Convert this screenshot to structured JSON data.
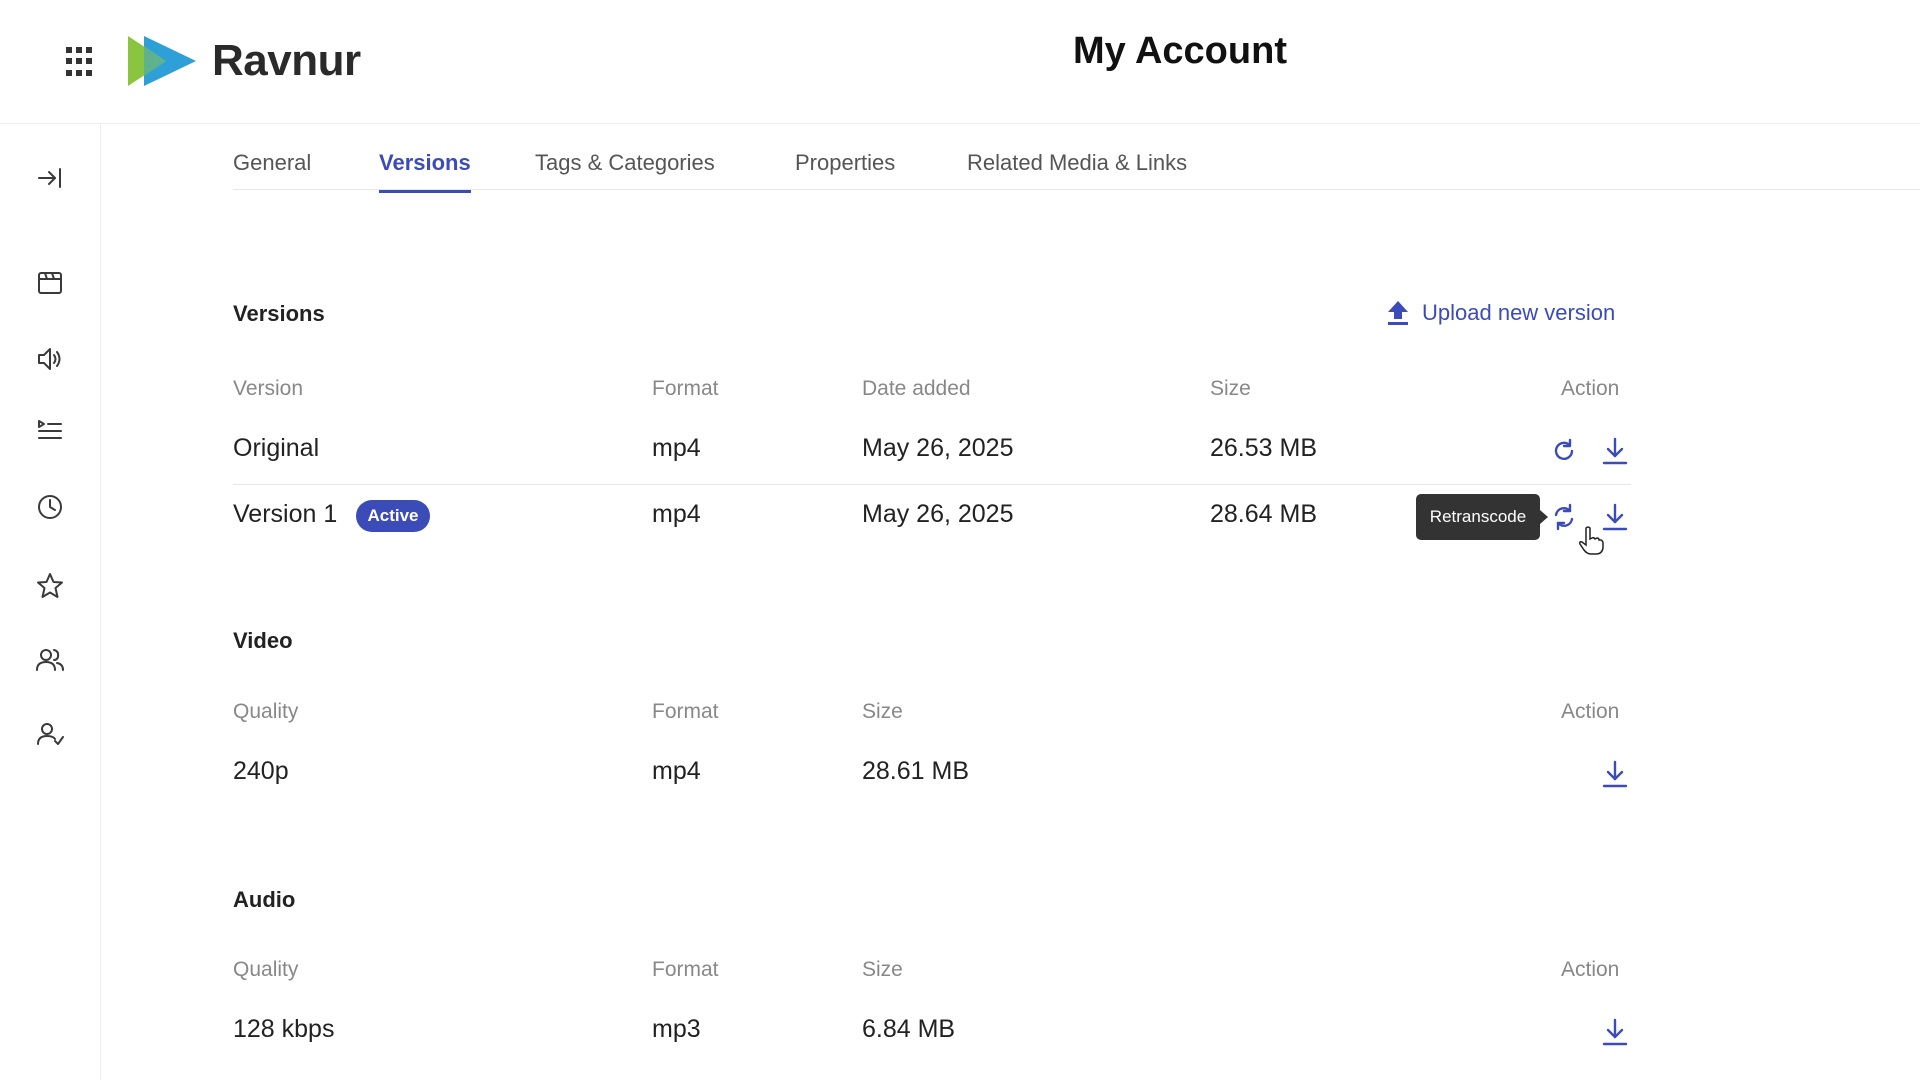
{
  "header": {
    "brand": "Ravnur",
    "title": "My Account",
    "logo_colors": [
      "#8bc53f",
      "#2f9fd8"
    ]
  },
  "sidebar": {
    "items": [
      {
        "icon": "collapse-icon"
      },
      {
        "icon": "media-icon"
      },
      {
        "icon": "audio-icon"
      },
      {
        "icon": "playlist-icon"
      },
      {
        "icon": "history-icon"
      },
      {
        "icon": "star-icon"
      },
      {
        "icon": "users-icon"
      },
      {
        "icon": "user-check-icon"
      }
    ]
  },
  "tabs": [
    {
      "label": "General"
    },
    {
      "label": "Versions",
      "active": true
    },
    {
      "label": "Tags & Categories"
    },
    {
      "label": "Properties"
    },
    {
      "label": "Related Media & Links"
    }
  ],
  "versions": {
    "title": "Versions",
    "upload_label": "Upload new version",
    "headers": {
      "version": "Version",
      "format": "Format",
      "date": "Date added",
      "size": "Size",
      "action": "Action"
    },
    "rows": [
      {
        "version": "Original",
        "format": "mp4",
        "date": "May 26, 2025",
        "size": "26.53 MB"
      },
      {
        "version": "Version 1",
        "badge": "Active",
        "format": "mp4",
        "date": "May 26, 2025",
        "size": "28.64 MB"
      }
    ],
    "tooltip": "Retranscode"
  },
  "video": {
    "title": "Video",
    "headers": {
      "quality": "Quality",
      "format": "Format",
      "size": "Size",
      "action": "Action"
    },
    "rows": [
      {
        "quality": "240p",
        "format": "mp4",
        "size": "28.61 MB"
      }
    ]
  },
  "audio": {
    "title": "Audio",
    "headers": {
      "quality": "Quality",
      "format": "Format",
      "size": "Size",
      "action": "Action"
    },
    "rows": [
      {
        "quality": "128 kbps",
        "format": "mp3",
        "size": "6.84 MB"
      }
    ]
  },
  "accent_color": "#3b4cb8"
}
